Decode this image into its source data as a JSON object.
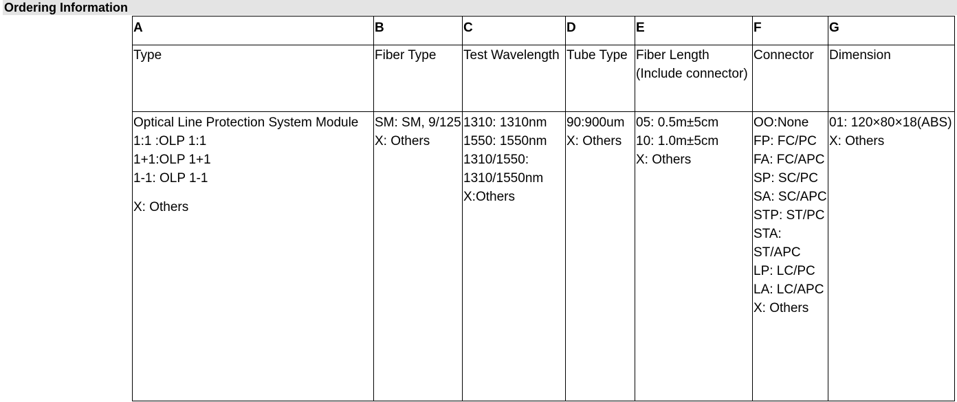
{
  "title": "Ordering Information",
  "columns": [
    {
      "letter": "A",
      "header": "Type"
    },
    {
      "letter": "B",
      "header": "Fiber Type"
    },
    {
      "letter": "C",
      "header": "Test Wavelength"
    },
    {
      "letter": "D",
      "header": "Tube Type"
    },
    {
      "letter": "E",
      "header": "Fiber Length (Include connector)"
    },
    {
      "letter": "F",
      "header": "Connector"
    },
    {
      "letter": "G",
      "header": "Dimension"
    }
  ],
  "options": {
    "type": {
      "module": "Optical Line Protection System Module",
      "o1": "1:1 :OLP 1:1",
      "o2": "1+1:OLP 1+1",
      "o3": "1-1: OLP 1-1",
      "others": "X: Others"
    },
    "fiber_type": {
      "sm": "SM: SM, 9/125",
      "others": "X: Others"
    },
    "wavelength": {
      "w1": "1310: 1310nm",
      "w2": "1550: 1550nm",
      "w3": "1310/1550: 1310/1550nm",
      "others": "X:Others"
    },
    "tube": {
      "t1": "90:900um",
      "others": "X: Others"
    },
    "length": {
      "l1": "05: 0.5m±5cm",
      "l2": "10: 1.0m±5cm",
      "others": "X: Others"
    },
    "connector": {
      "c1": "OO:None",
      "c2": "FP: FC/PC",
      "c3": "FA: FC/APC",
      "c4": "SP: SC/PC",
      "c5": "SA: SC/APC",
      "c6": "STP: ST/PC",
      "c7": "STA: ST/APC",
      "c8": "LP: LC/PC",
      "c9": "LA: LC/APC",
      "others": "X: Others"
    },
    "dimension": {
      "d1": "01: 120×80×18(ABS)",
      "others": "X: Others"
    }
  }
}
